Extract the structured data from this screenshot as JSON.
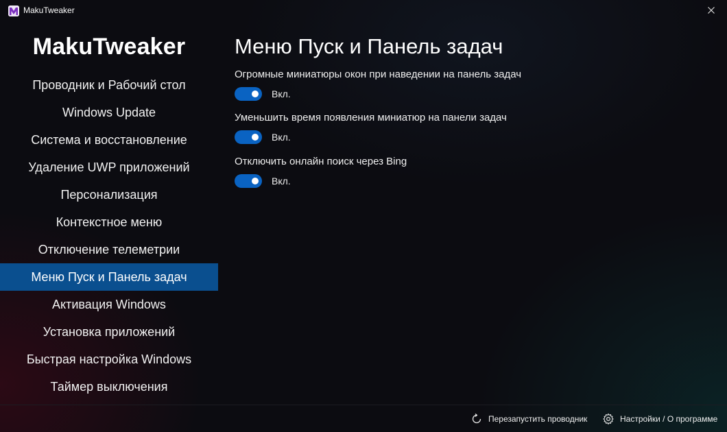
{
  "window": {
    "title": "MakuTweaker",
    "icons": {
      "app": "makutweaker-logo-icon",
      "close": "close-icon"
    }
  },
  "sidebar": {
    "brand": "MakuTweaker",
    "items": [
      {
        "label": "Проводник и Рабочий стол",
        "active": false
      },
      {
        "label": "Windows Update",
        "active": false
      },
      {
        "label": "Система и восстановление",
        "active": false
      },
      {
        "label": "Удаление UWP приложений",
        "active": false
      },
      {
        "label": "Персонализация",
        "active": false
      },
      {
        "label": "Контекстное меню",
        "active": false
      },
      {
        "label": "Отключение телеметрии",
        "active": false
      },
      {
        "label": "Меню Пуск и Панель задач",
        "active": true
      },
      {
        "label": "Активация Windows",
        "active": false
      },
      {
        "label": "Установка приложений",
        "active": false
      },
      {
        "label": "Быстрая настройка Windows",
        "active": false
      },
      {
        "label": "Таймер выключения",
        "active": false
      }
    ]
  },
  "main": {
    "title": "Меню Пуск и Панель задач",
    "settings": [
      {
        "label": "Огромные миниатюры окон при наведении на панель задач",
        "state": "Вкл.",
        "on": true
      },
      {
        "label": "Уменьшить время появления миниатюр на панели задач",
        "state": "Вкл.",
        "on": true
      },
      {
        "label": "Отключить онлайн поиск через Bing",
        "state": "Вкл.",
        "on": true
      }
    ]
  },
  "footer": {
    "restart_label": "Перезапустить проводник",
    "settings_label": "Настройки / О программе",
    "icons": {
      "restart": "refresh-icon",
      "settings": "gear-icon"
    }
  },
  "colors": {
    "accent": "#0a63c2",
    "active_nav": "#0a4f8f",
    "background": "#0c0c11"
  }
}
